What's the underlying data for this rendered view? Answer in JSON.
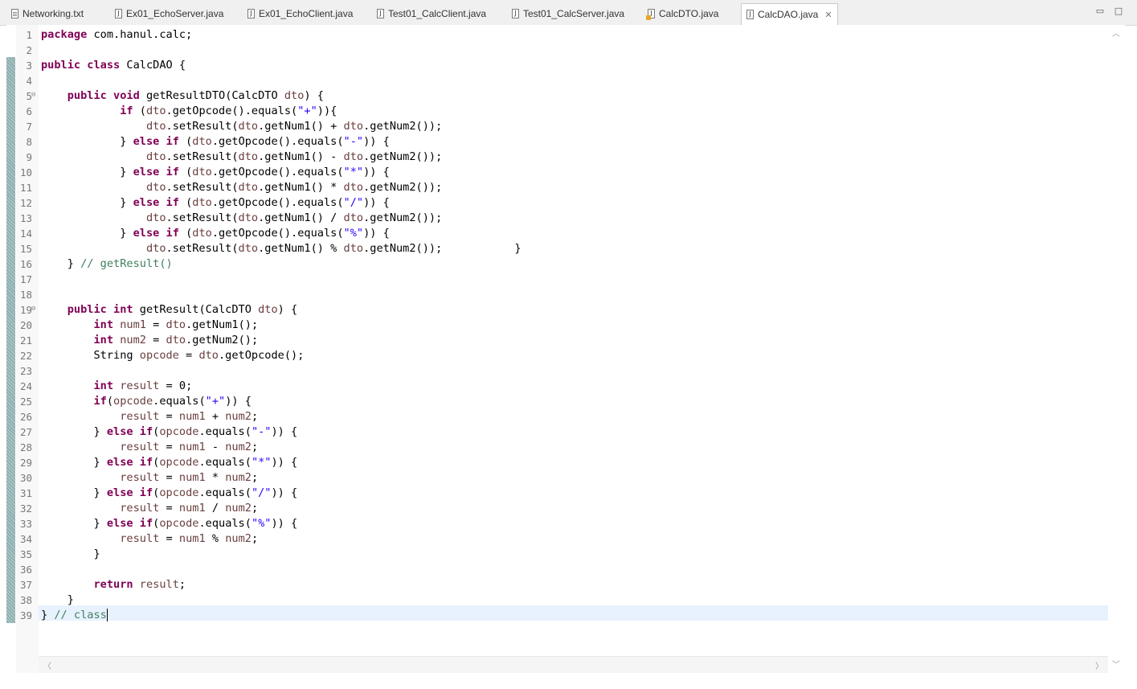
{
  "tabs": [
    {
      "label": "Networking.txt",
      "icon": "text-file-icon"
    },
    {
      "label": "Ex01_EchoServer.java",
      "icon": "java-file-icon"
    },
    {
      "label": "Ex01_EchoClient.java",
      "icon": "java-file-icon"
    },
    {
      "label": "Test01_CalcClient.java",
      "icon": "java-file-icon"
    },
    {
      "label": "Test01_CalcServer.java",
      "icon": "java-file-icon"
    },
    {
      "label": "CalcDTO.java",
      "icon": "java-file-warning-icon"
    },
    {
      "label": "CalcDAO.java",
      "icon": "java-file-icon",
      "active": true
    }
  ],
  "window": {
    "minimize": "▭",
    "maximize": "□"
  },
  "editor": {
    "line_numbers": [
      "1",
      "2",
      "3",
      "4",
      "5",
      "6",
      "7",
      "8",
      "9",
      "10",
      "11",
      "12",
      "13",
      "14",
      "15",
      "16",
      "17",
      "18",
      "19",
      "20",
      "21",
      "22",
      "23",
      "24",
      "25",
      "26",
      "27",
      "28",
      "29",
      "30",
      "31",
      "32",
      "33",
      "34",
      "35",
      "36",
      "37",
      "38",
      "39"
    ],
    "fold_markers": {
      "5": "⊖",
      "19": "⊖"
    },
    "current_line": 39,
    "code_lines": [
      "package com.hanul.calc;",
      "",
      "public class CalcDAO {",
      "",
      "    public void getResultDTO(CalcDTO dto) {",
      "            if (dto.getOpcode().equals(\"+\")){",
      "                dto.setResult(dto.getNum1() + dto.getNum2());",
      "            } else if (dto.getOpcode().equals(\"-\")) {",
      "                dto.setResult(dto.getNum1() - dto.getNum2());",
      "            } else if (dto.getOpcode().equals(\"*\")) {",
      "                dto.setResult(dto.getNum1() * dto.getNum2());",
      "            } else if (dto.getOpcode().equals(\"/\")) {",
      "                dto.setResult(dto.getNum1() / dto.getNum2());",
      "            } else if (dto.getOpcode().equals(\"%\")) {",
      "                dto.setResult(dto.getNum1() % dto.getNum2());           }",
      "    } // getResult()",
      "",
      "",
      "    public int getResult(CalcDTO dto) {",
      "        int num1 = dto.getNum1();",
      "        int num2 = dto.getNum2();",
      "        String opcode = dto.getOpcode();",
      "",
      "        int result = 0;",
      "        if(opcode.equals(\"+\")) {",
      "            result = num1 + num2;",
      "        } else if(opcode.equals(\"-\")) {",
      "            result = num1 - num2;",
      "        } else if(opcode.equals(\"*\")) {",
      "            result = num1 * num2;",
      "        } else if(opcode.equals(\"/\")) {",
      "            result = num1 / num2;",
      "        } else if(opcode.equals(\"%\")) {",
      "            result = num1 % num2;",
      "        }",
      "",
      "        return result;",
      "    }",
      "} // class"
    ]
  },
  "colors": {
    "keyword": "#7f0055",
    "string": "#2a00ff",
    "comment": "#3f7f5f",
    "local_variable": "#6a3e3e",
    "current_line_bg": "#e8f2fe"
  }
}
